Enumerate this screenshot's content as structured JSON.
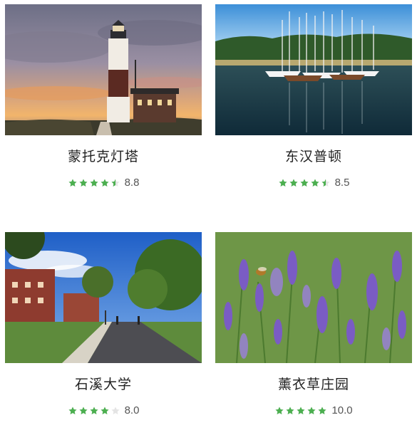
{
  "colors": {
    "star_filled": "#4caf50",
    "star_empty": "#e4e4e4",
    "title": "#222222",
    "score": "#555555"
  },
  "cards": [
    {
      "title": "蒙托克灯塔",
      "score": "8.8",
      "stars": 4.5,
      "image": "montauk-lighthouse-sunset-photo"
    },
    {
      "title": "东汉普顿",
      "score": "8.5",
      "stars": 4.5,
      "image": "sailboats-harbor-photo"
    },
    {
      "title": "石溪大学",
      "score": "8.0",
      "stars": 4,
      "image": "campus-walkway-photo"
    },
    {
      "title": "薰衣草庄园",
      "score": "10.0",
      "stars": 5,
      "image": "lavender-field-photo"
    }
  ]
}
